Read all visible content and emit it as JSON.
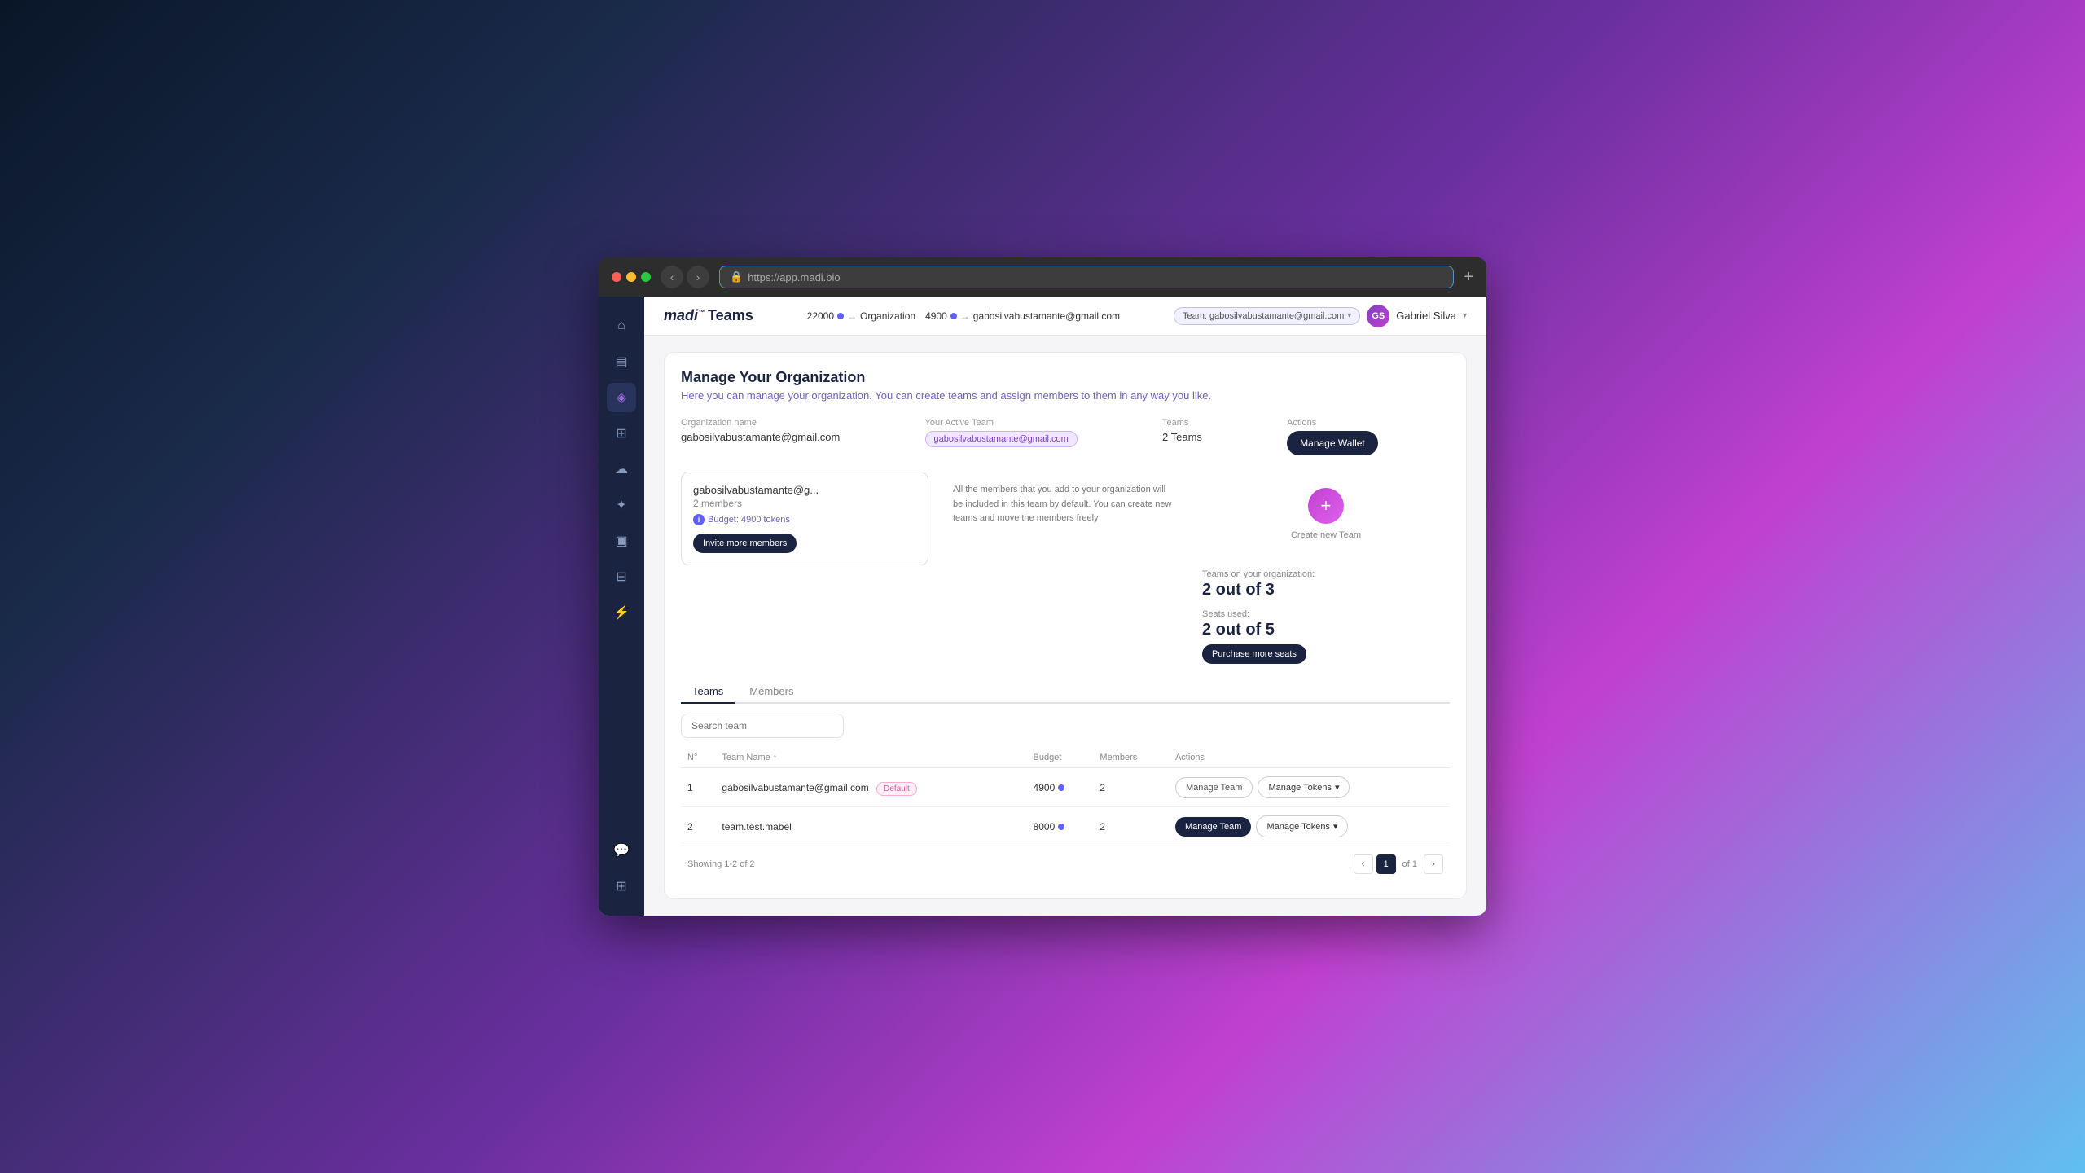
{
  "browser": {
    "url": "https://app.madi.bio",
    "new_tab_label": "+"
  },
  "topbar": {
    "logo_madi": "madi",
    "logo_trademark": "™",
    "logo_teams": "Teams",
    "tokens_left": "22000",
    "tokens_left_label": "Organization",
    "tokens_right": "4900",
    "tokens_right_label": "gabosilvabustamante@gmail.com",
    "team_badge": "Team: gabosilvabustamante@gmail.com",
    "user_name": "Gabriel Silva",
    "user_initials": "GS"
  },
  "page": {
    "title": "Manage Your Organization",
    "subtitle": "Here you can manage your organization. You can create teams and assign members to them in any way you like."
  },
  "org_fields": {
    "org_name_label": "Organization name",
    "org_name_value": "gabosilvabustamante@gmail.com",
    "active_team_label": "Your Active Team",
    "active_team_value": "gabosilvabustamante@gmail.com",
    "teams_label": "Teams",
    "teams_value": "2 Teams",
    "actions_label": "Actions",
    "manage_wallet_btn": "Manage Wallet"
  },
  "team_card": {
    "name": "gabosilvabustamante@g...",
    "members": "2 members",
    "budget_label": "Budget: 4900 tokens",
    "invite_btn": "Invite more members",
    "description": "All the members that you add to your organization will be included in this team by default. You can create new teams and move the members freely"
  },
  "create_team": {
    "label": "Create new Team"
  },
  "org_stats": {
    "teams_on_org_label": "Teams on your organization:",
    "teams_count": "2 out of 3",
    "seats_used_label": "Seats used:",
    "seats_count": "2 out of 5",
    "purchase_seats_btn": "Purchase more seats"
  },
  "tabs": [
    {
      "label": "Teams",
      "active": true
    },
    {
      "label": "Members",
      "active": false
    }
  ],
  "search": {
    "placeholder": "Search team"
  },
  "table": {
    "headers": [
      "N°",
      "Team Name ↑",
      "Budget",
      "Members",
      "Actions"
    ],
    "rows": [
      {
        "num": "1",
        "name": "gabosilvabustamante@gmail.com",
        "is_default": true,
        "budget": "4900",
        "members": "2",
        "manage_team_disabled": true,
        "manage_team_label": "Manage Team",
        "manage_tokens_label": "Manage Tokens"
      },
      {
        "num": "2",
        "name": "team.test.mabel",
        "is_default": false,
        "budget": "8000",
        "members": "2",
        "manage_team_disabled": false,
        "manage_team_label": "Manage Team",
        "manage_tokens_label": "Manage Tokens"
      }
    ]
  },
  "pagination": {
    "showing": "Showing 1-2 of 2",
    "page": "1",
    "of": "of 1"
  },
  "sidebar": {
    "items": [
      {
        "icon": "⌂",
        "name": "home-icon"
      },
      {
        "icon": "▤",
        "name": "dashboard-icon"
      },
      {
        "icon": "◈",
        "name": "tokens-icon",
        "active": true
      },
      {
        "icon": "⊞",
        "name": "grid-icon"
      },
      {
        "icon": "☁",
        "name": "cloud-icon"
      },
      {
        "icon": "✦",
        "name": "star-icon"
      },
      {
        "icon": "▣",
        "name": "manage-icon"
      },
      {
        "icon": "⊟",
        "name": "billing-icon"
      },
      {
        "icon": "⚡",
        "name": "lightning-icon"
      }
    ],
    "bottom": [
      {
        "icon": "💬",
        "name": "chat-icon"
      },
      {
        "icon": "⊞",
        "name": "apps-icon"
      }
    ]
  }
}
